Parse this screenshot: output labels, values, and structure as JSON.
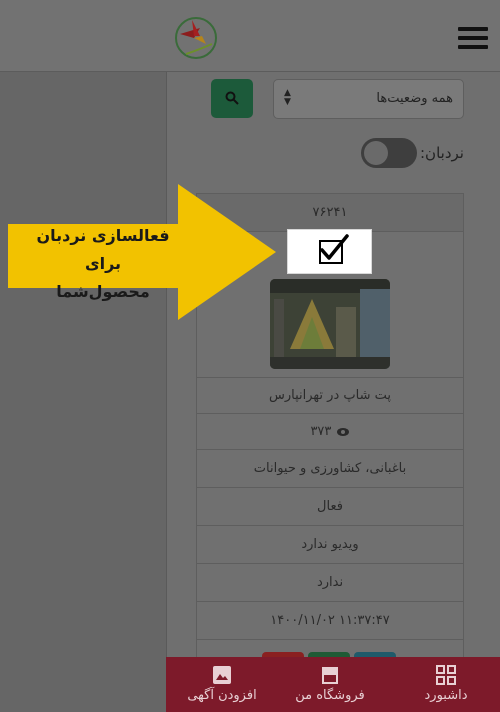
{
  "header": {
    "logo_icon": "bird-logo-icon",
    "menu_icon": "hamburger-menu-icon"
  },
  "filters": {
    "status_select_value": "همه وضعیت‌ها",
    "search_icon": "search-icon",
    "search_button_color": "#1c5a3a"
  },
  "ladder": {
    "label": "نردبان:",
    "enabled": false
  },
  "listing": {
    "id": "۷۶۲۴۱",
    "ladder_checked": true,
    "title": "پت شاپ در تهرانپارس",
    "views": "۳۷۳",
    "views_icon": "eye-icon",
    "category": "باغبانی، کشاورزی و حیوانات",
    "status": "فعال",
    "video": "ویدیو ندارد",
    "extra": "ندارد",
    "date": "۱۴۰۰/۱۱/۰۲ ۱۱:۳۷:۴۷"
  },
  "callout": {
    "line1": "فعالسازی نردبان برای",
    "line2": "محصول‌شما",
    "color": "#f2c200"
  },
  "bottom_nav": {
    "dashboard": "داشبورد",
    "my_store": "فروشگاه من",
    "add_ad": "افزودن آگهی",
    "color": "#7d1a2a"
  }
}
